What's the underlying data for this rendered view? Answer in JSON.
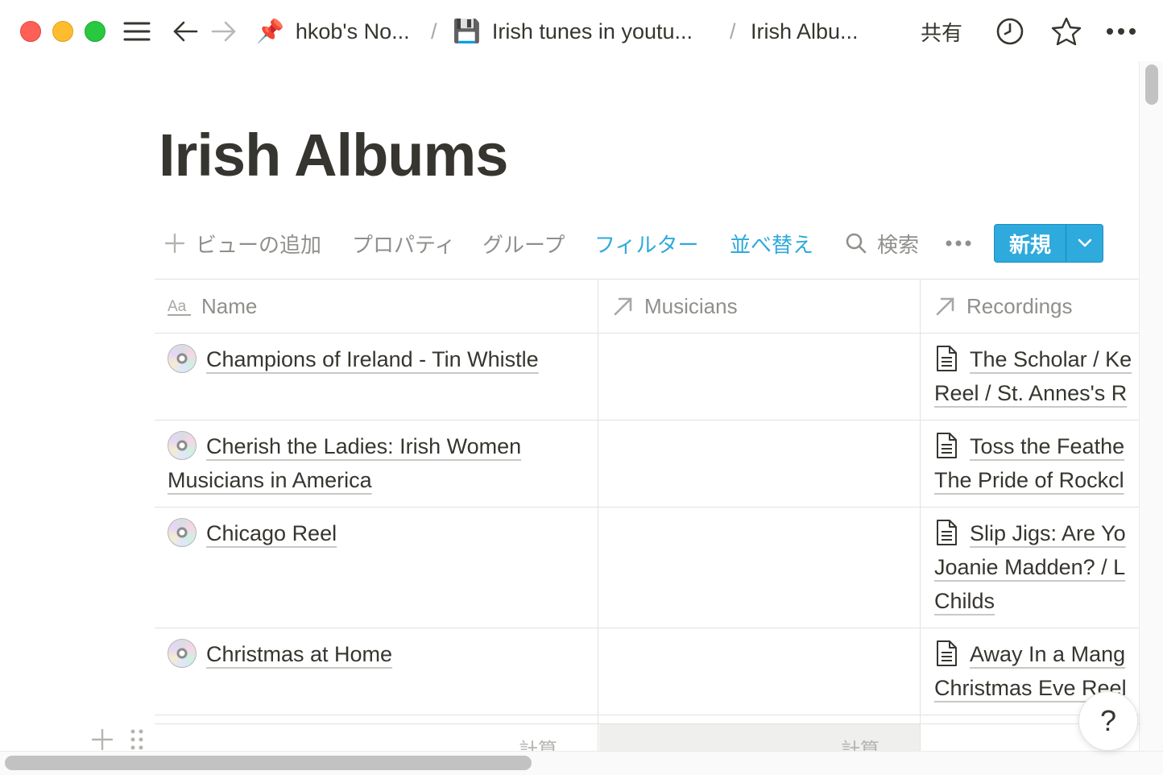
{
  "topbar": {
    "breadcrumbs": [
      {
        "emoji": "📌",
        "label": "hkob's No..."
      },
      {
        "emoji": "💾",
        "label": "Irish tunes in youtu..."
      },
      {
        "emoji": "",
        "label": "Irish Albu..."
      }
    ],
    "separator": "/",
    "share_label": "共有",
    "icons": [
      "sidebar-toggle-icon",
      "back-arrow-icon",
      "forward-arrow-icon",
      "clock-icon",
      "star-icon",
      "more-icon"
    ]
  },
  "page": {
    "title": "Irish Albums"
  },
  "toolbar": {
    "add_view": "ビューの追加",
    "properties": "プロパティ",
    "group": "グループ",
    "filter": "フィルター",
    "sort": "並べ替え",
    "search": "検索",
    "new_button": "新規",
    "accent_color": "#2eaadc"
  },
  "table": {
    "columns": [
      {
        "name": "Name",
        "icon": "text-property-icon"
      },
      {
        "name": "Musicians",
        "icon": "relation-arrow-icon"
      },
      {
        "name": "Recordings",
        "icon": "relation-arrow-icon"
      }
    ],
    "rows": [
      {
        "name": "Champions of Ireland - Tin Whistle",
        "musicians": "",
        "recordings": [
          "The Scholar / Ke",
          "Reel / St. Annes's R"
        ]
      },
      {
        "name": "Cherish the Ladies: Irish Women",
        "name_cont": "Musicians in America",
        "musicians": "",
        "recordings": [
          "Toss the Feathe",
          "The Pride of Rockcl"
        ]
      },
      {
        "name": "Chicago Reel",
        "musicians": "",
        "recordings": [
          "Slip Jigs: Are Yo",
          "Joanie Madden? / L",
          "Childs"
        ]
      },
      {
        "name": "Christmas at Home",
        "musicians": "",
        "recordings": [
          "Away In a Mang",
          "Christmas Eve Reel"
        ]
      }
    ],
    "footer": {
      "calc_label": "計算"
    }
  },
  "help_label": "?"
}
